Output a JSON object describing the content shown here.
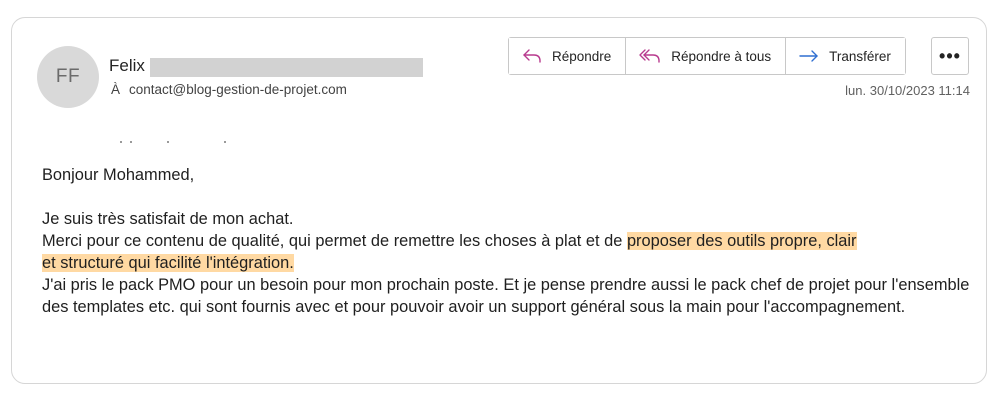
{
  "sender": {
    "initials": "FF",
    "name": "Felix",
    "to_prefix": "À",
    "to_address": "contact@blog-gestion-de-projet.com"
  },
  "actions": {
    "reply": "Répondre",
    "reply_all": "Répondre à tous",
    "forward": "Transférer",
    "more": "•••"
  },
  "date": "lun. 30/10/2023 11:14",
  "message": {
    "greeting": "Bonjour Mohammed,",
    "line1": "Je suis très satisfait de mon achat.",
    "line2_before": "Merci pour ce contenu de qualité, qui permet de remettre les choses à plat et de ",
    "line2_highlight_a": "proposer des outils propre, clair",
    "line2_highlight_b": "et structuré qui facilité l'intégration.",
    "paragraph3": "J'ai pris le pack PMO pour un besoin pour mon prochain poste. Et je pense prendre aussi le pack chef de projet pour l'ensemble des templates etc. qui sont fournis avec et pour pouvoir avoir un support général sous la main pour l'accompagnement."
  },
  "colors": {
    "highlight": "#ffd9a3",
    "reply_icon": "#b83a8e",
    "forward_icon": "#2f6fd1",
    "avatar_bg": "#d9d9d9"
  },
  "icons": {
    "reply": "reply-arrow-icon",
    "reply_all": "reply-all-arrow-icon",
    "forward": "forward-arrow-icon",
    "more": "more-dots-icon"
  }
}
